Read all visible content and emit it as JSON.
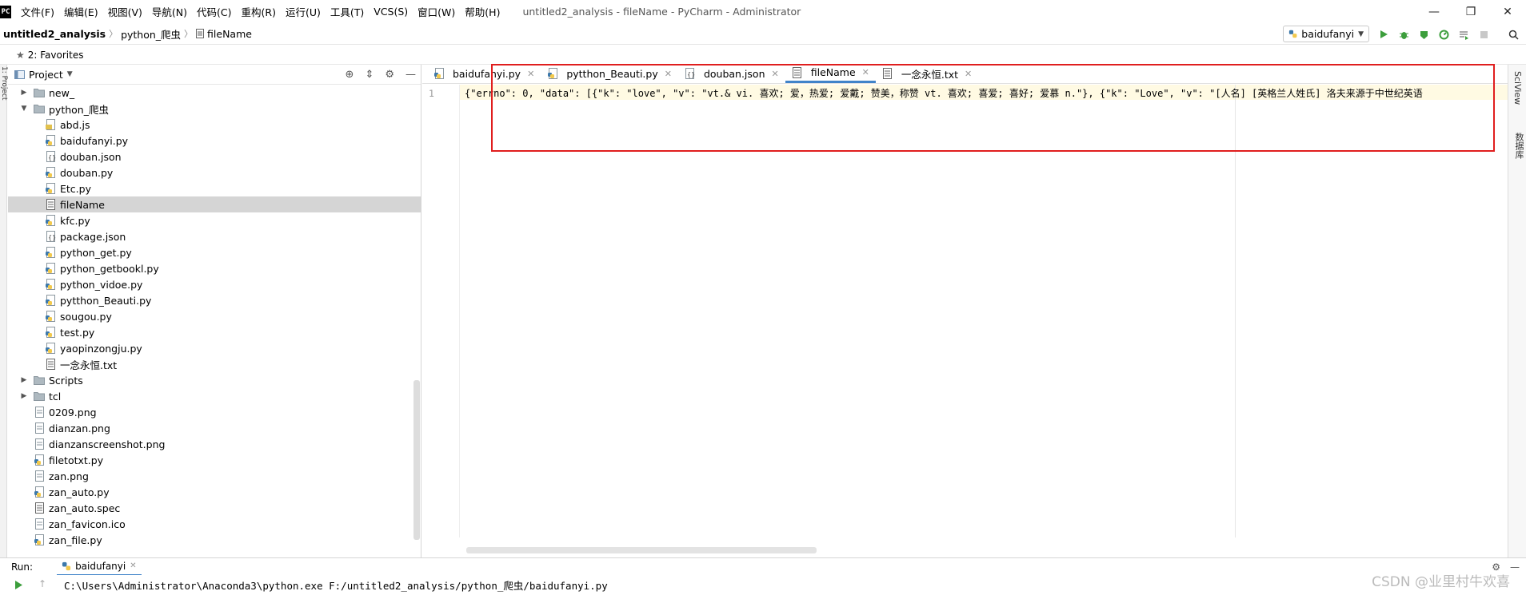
{
  "menubar": {
    "app_icon": "PC",
    "items": [
      "文件(F)",
      "编辑(E)",
      "视图(V)",
      "导航(N)",
      "代码(C)",
      "重构(R)",
      "运行(U)",
      "工具(T)",
      "VCS(S)",
      "窗口(W)",
      "帮助(H)"
    ],
    "window_title": "untitled2_analysis - fileName - PyCharm - Administrator"
  },
  "window_controls": {
    "minimize": "—",
    "restore": "❐",
    "close": "✕"
  },
  "navbar": {
    "crumbs": [
      "untitled2_analysis",
      "python_爬虫",
      "fileName"
    ],
    "run_config": "baidufanyi"
  },
  "favorites": {
    "label": "2: Favorites"
  },
  "left_strip": {
    "label": "1: Project"
  },
  "right_strip": {
    "sciview": "SciView",
    "database": "数据库"
  },
  "project_panel": {
    "title": "Project",
    "tree": [
      {
        "label": "new_",
        "type": "folder",
        "level": 1,
        "expanded": false,
        "selected": false
      },
      {
        "label": "python_爬虫",
        "type": "folder",
        "level": 1,
        "expanded": true,
        "selected": false
      },
      {
        "label": "abd.js",
        "type": "js",
        "level": 2,
        "selected": false
      },
      {
        "label": "baidufanyi.py",
        "type": "py",
        "level": 2,
        "selected": false
      },
      {
        "label": "douban.json",
        "type": "json",
        "level": 2,
        "selected": false
      },
      {
        "label": "douban.py",
        "type": "py",
        "level": 2,
        "selected": false
      },
      {
        "label": "Etc.py",
        "type": "py",
        "level": 2,
        "selected": false
      },
      {
        "label": "fileName",
        "type": "txt",
        "level": 2,
        "selected": true
      },
      {
        "label": "kfc.py",
        "type": "py",
        "level": 2,
        "selected": false
      },
      {
        "label": "package.json",
        "type": "json",
        "level": 2,
        "selected": false
      },
      {
        "label": "python_get.py",
        "type": "py",
        "level": 2,
        "selected": false
      },
      {
        "label": "python_getbookl.py",
        "type": "py",
        "level": 2,
        "selected": false
      },
      {
        "label": "python_vidoe.py",
        "type": "py",
        "level": 2,
        "selected": false
      },
      {
        "label": "pytthon_Beauti.py",
        "type": "py",
        "level": 2,
        "selected": false
      },
      {
        "label": "sougou.py",
        "type": "py",
        "level": 2,
        "selected": false
      },
      {
        "label": "test.py",
        "type": "py",
        "level": 2,
        "selected": false
      },
      {
        "label": "yaopinzongju.py",
        "type": "py",
        "level": 2,
        "selected": false
      },
      {
        "label": "一念永恒.txt",
        "type": "txt",
        "level": 2,
        "selected": false
      },
      {
        "label": "Scripts",
        "type": "folder",
        "level": 1,
        "expanded": false,
        "selected": false
      },
      {
        "label": "tcl",
        "type": "folder",
        "level": 1,
        "expanded": false,
        "selected": false
      },
      {
        "label": "0209.png",
        "type": "img",
        "level": 1,
        "selected": false
      },
      {
        "label": "dianzan.png",
        "type": "img",
        "level": 1,
        "selected": false
      },
      {
        "label": "dianzanscreenshot.png",
        "type": "img",
        "level": 1,
        "selected": false
      },
      {
        "label": "filetotxt.py",
        "type": "py",
        "level": 1,
        "selected": false
      },
      {
        "label": "zan.png",
        "type": "img",
        "level": 1,
        "selected": false
      },
      {
        "label": "zan_auto.py",
        "type": "py",
        "level": 1,
        "selected": false
      },
      {
        "label": "zan_auto.spec",
        "type": "txt",
        "level": 1,
        "selected": false
      },
      {
        "label": "zan_favicon.ico",
        "type": "img",
        "level": 1,
        "selected": false
      },
      {
        "label": "zan_file.py",
        "type": "py",
        "level": 1,
        "selected": false
      }
    ]
  },
  "editor": {
    "tabs": [
      {
        "label": "baidufanyi.py",
        "type": "py",
        "active": false
      },
      {
        "label": "pytthon_Beauti.py",
        "type": "py",
        "active": false
      },
      {
        "label": "douban.json",
        "type": "json",
        "active": false
      },
      {
        "label": "fileName",
        "type": "txt",
        "active": true
      },
      {
        "label": "一念永恒.txt",
        "type": "txt",
        "active": false
      }
    ],
    "line_number": "1",
    "code_line": "{\"errno\": 0, \"data\": [{\"k\": \"love\", \"v\": \"vt.& vi. 喜欢; 爱，热爱; 爱戴; 赞美，称赞 vt. 喜欢; 喜爱; 喜好; 爱慕 n.\"}, {\"k\": \"Love\", \"v\": \"[人名] [英格兰人姓氏] 洛夫来源于中世纪英语"
  },
  "run_bar": {
    "label": "Run:",
    "tab": "baidufanyi"
  },
  "console": {
    "command": "C:\\Users\\Administrator\\Anaconda3\\python.exe F:/untitled2_analysis/python_爬虫/baidufanyi.py"
  },
  "watermark": "CSDN @业里村牛欢喜",
  "colors": {
    "accent": "#4083c9",
    "highlight_box": "#e01e1e",
    "selection": "#d5d5d5",
    "run_green": "#3c9e3c"
  }
}
